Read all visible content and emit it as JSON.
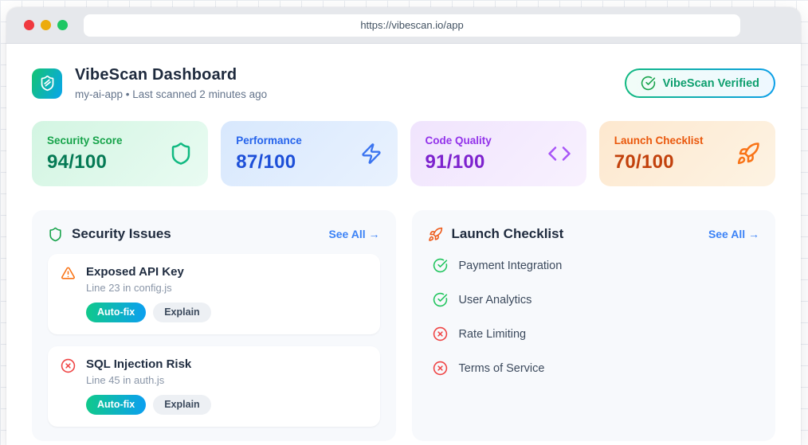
{
  "browser": {
    "url": "https://vibescan.io/app"
  },
  "header": {
    "title": "VibeScan Dashboard",
    "subtitle": "my-ai-app • Last scanned 2 minutes ago",
    "verified_badge": "VibeScan Verified"
  },
  "colors": {
    "accent_green": "#10b981",
    "accent_blue": "#0ea5e9",
    "link_blue": "#3b82f6",
    "warning_orange": "#f97316",
    "error_red": "#ef4444",
    "success_green": "#22c55e"
  },
  "stats": [
    {
      "label": "Security Score",
      "value": "94/100",
      "icon": "shield-icon",
      "theme": "green"
    },
    {
      "label": "Performance",
      "value": "87/100",
      "icon": "zap-icon",
      "theme": "blue"
    },
    {
      "label": "Code Quality",
      "value": "91/100",
      "icon": "code-icon",
      "theme": "purple"
    },
    {
      "label": "Launch Checklist",
      "value": "70/100",
      "icon": "rocket-icon",
      "theme": "orange"
    }
  ],
  "security_panel": {
    "title": "Security Issues",
    "see_all": "See All →",
    "issues": [
      {
        "title": "Exposed API Key",
        "location": "Line 23 in config.js",
        "severity": "warning",
        "autofix_label": "Auto-fix",
        "explain_label": "Explain"
      },
      {
        "title": "SQL Injection Risk",
        "location": "Line 45 in auth.js",
        "severity": "error",
        "autofix_label": "Auto-fix",
        "explain_label": "Explain"
      }
    ]
  },
  "launch_panel": {
    "title": "Launch Checklist",
    "see_all": "See All →",
    "items": [
      {
        "label": "Payment Integration",
        "status": "done"
      },
      {
        "label": "User Analytics",
        "status": "done"
      },
      {
        "label": "Rate Limiting",
        "status": "missing"
      },
      {
        "label": "Terms of Service",
        "status": "missing"
      }
    ]
  }
}
